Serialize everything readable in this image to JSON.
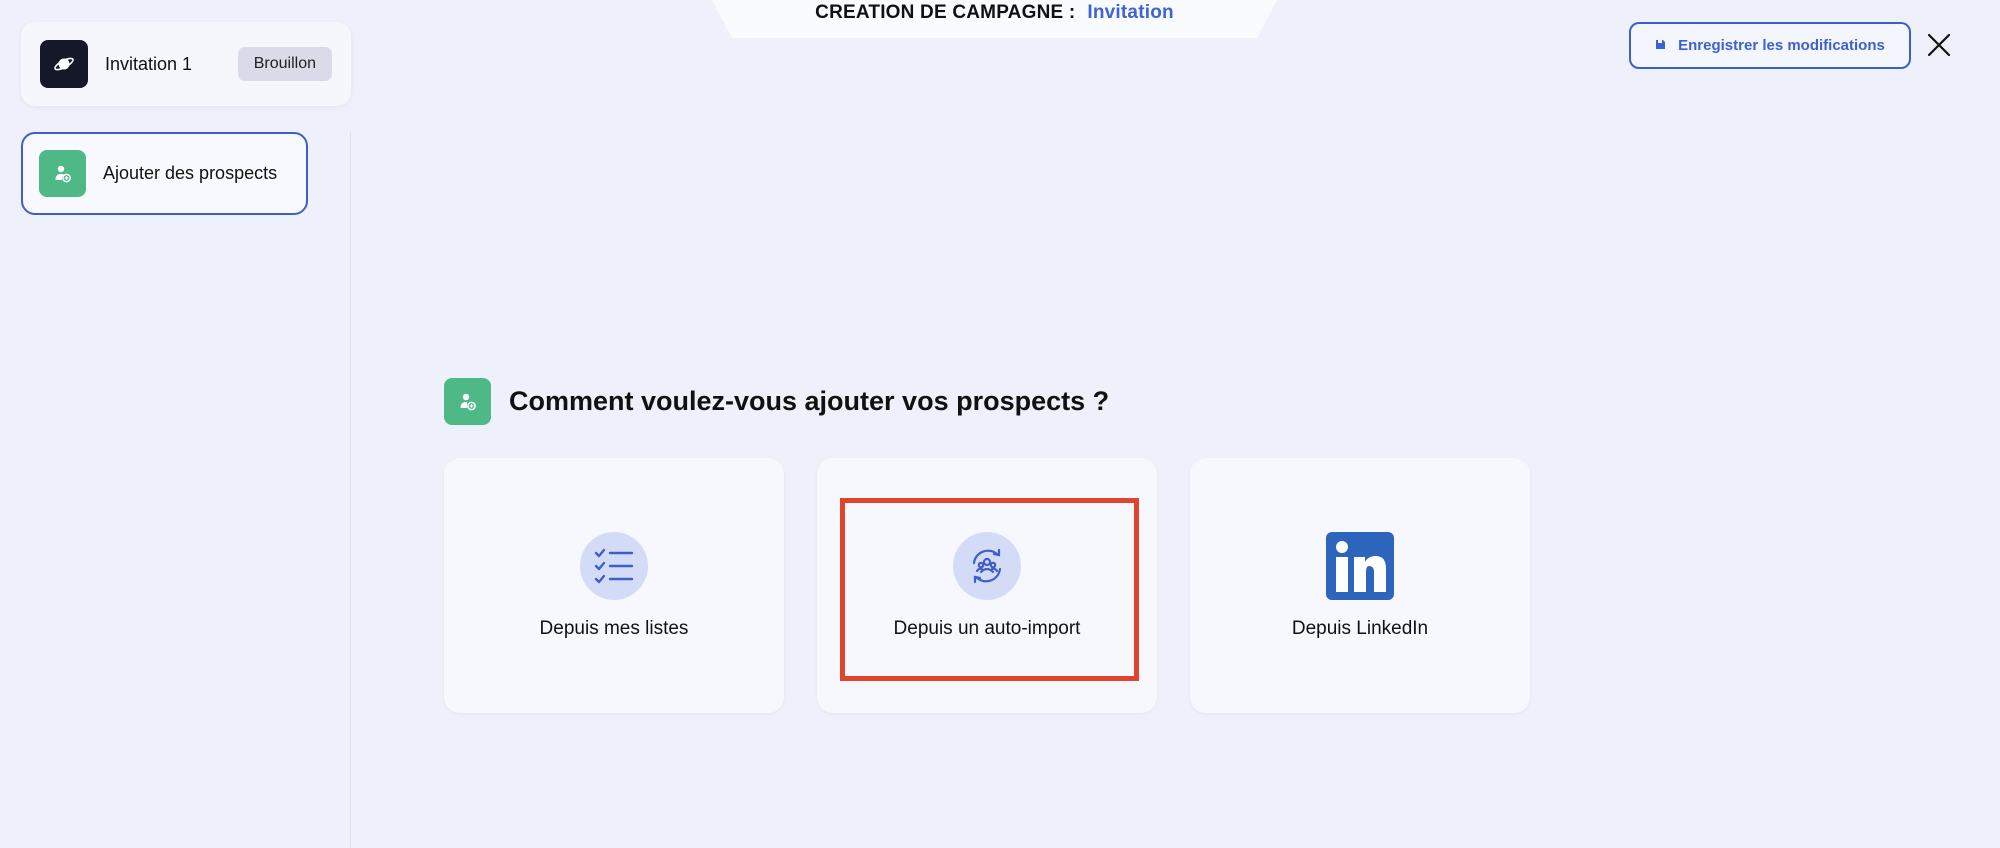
{
  "header": {
    "label": "CREATION DE CAMPAGNE :",
    "campaign_type": "Invitation"
  },
  "sidebar": {
    "campaign": {
      "name": "Invitation 1",
      "status": "Brouillon",
      "icon": "planet-icon"
    },
    "steps": [
      {
        "label": "Ajouter des prospects",
        "icon": "add-user-icon",
        "active": true
      }
    ]
  },
  "toolbar": {
    "save_label": "Enregistrer les modifications",
    "save_icon": "save-icon",
    "close_icon": "close-icon"
  },
  "main": {
    "title": "Comment voulez-vous ajouter vos prospects ?",
    "title_icon": "add-user-icon",
    "options": [
      {
        "label": "Depuis mes listes",
        "icon": "checklist-icon"
      },
      {
        "label": "Depuis un auto-import",
        "icon": "auto-import-icon"
      },
      {
        "label": "Depuis LinkedIn",
        "icon": "linkedin-icon"
      }
    ]
  },
  "colors": {
    "background": "#eef0fb",
    "accent": "#3e63d8",
    "green": "#4fb887",
    "highlight": "#e0452b",
    "linkedin": "#2d64bc"
  }
}
